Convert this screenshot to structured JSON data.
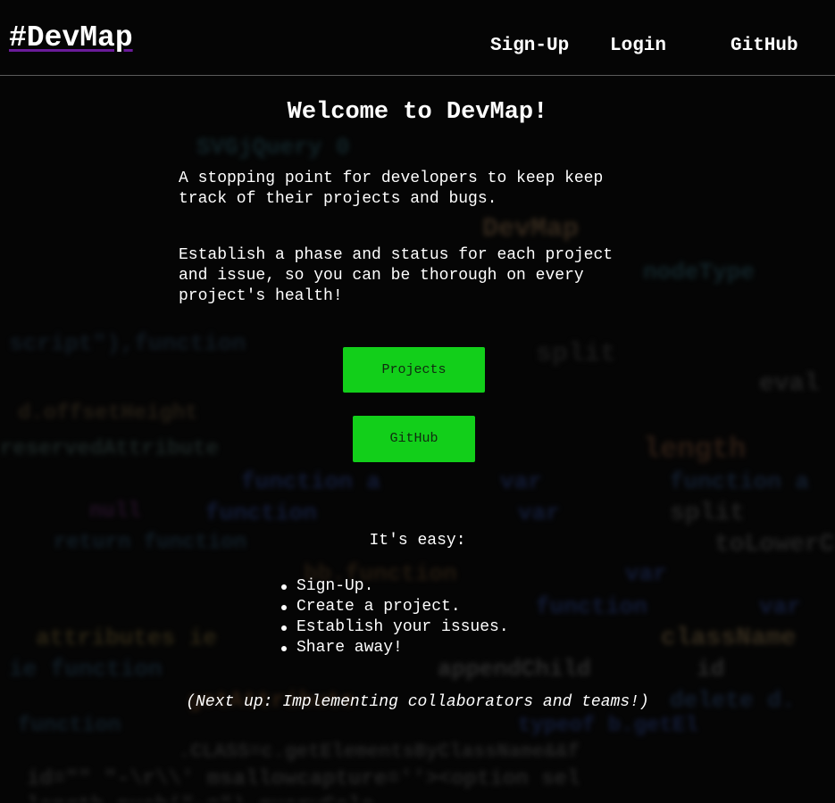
{
  "header": {
    "brand": "#DevMap",
    "nav": [
      "Sign-Up",
      "Login",
      "GitHub"
    ]
  },
  "main": {
    "title": "Welcome to DevMap!",
    "paragraph1": "A stopping point for developers to keep keep track of their projects and bugs.",
    "paragraph2": "Establish a phase and status for each project and issue, so you can be thorough on every project's health!",
    "projects_button": "Projects",
    "github_button": "GitHub",
    "easy_label": "It's easy:",
    "steps": [
      "Sign-Up.",
      "Create a project.",
      "Establish your issues.",
      "Share away!"
    ],
    "next_up": "(Next up: Implementing collaborators and teams!)"
  },
  "colors": {
    "background": "#050505",
    "accent_green": "#12cf1a",
    "brand_underline": "#6a1b9a",
    "divider": "#5b5b5b"
  }
}
